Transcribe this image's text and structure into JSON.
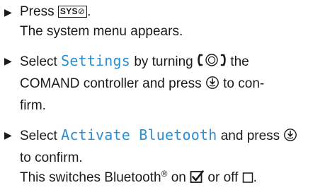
{
  "steps": [
    {
      "bullet": "▶",
      "press": "Press",
      "key_label": "SYS",
      "key_icon": "⊘",
      "period": ".",
      "result": "The system menu appears."
    },
    {
      "bullet": "▶",
      "select": "Select",
      "menu_item": "Settings",
      "turning": "by turning",
      "the": "the",
      "controller_line": "COMAND controller and press",
      "to_con": "to con-",
      "firm": "firm."
    },
    {
      "bullet": "▶",
      "select": "Select",
      "menu_item": "Activate Bluetooth",
      "and_press": "and press",
      "to_confirm": "to confirm.",
      "switch_text_a": "This switches Bluetooth",
      "registered": "®",
      "switch_text_b": "on",
      "or_off": "or off",
      "end_period": "."
    }
  ],
  "icons": {
    "rotate_controller": "controller-rotate-icon",
    "press_controller": "controller-press-icon",
    "checkbox_checked": "checkbox-checked-icon",
    "checkbox_unchecked": "checkbox-unchecked-icon",
    "sys_key_icon": "clock-icon"
  },
  "colors": {
    "text": "#1a1a1a",
    "menu_item": "#2b8fd6"
  }
}
